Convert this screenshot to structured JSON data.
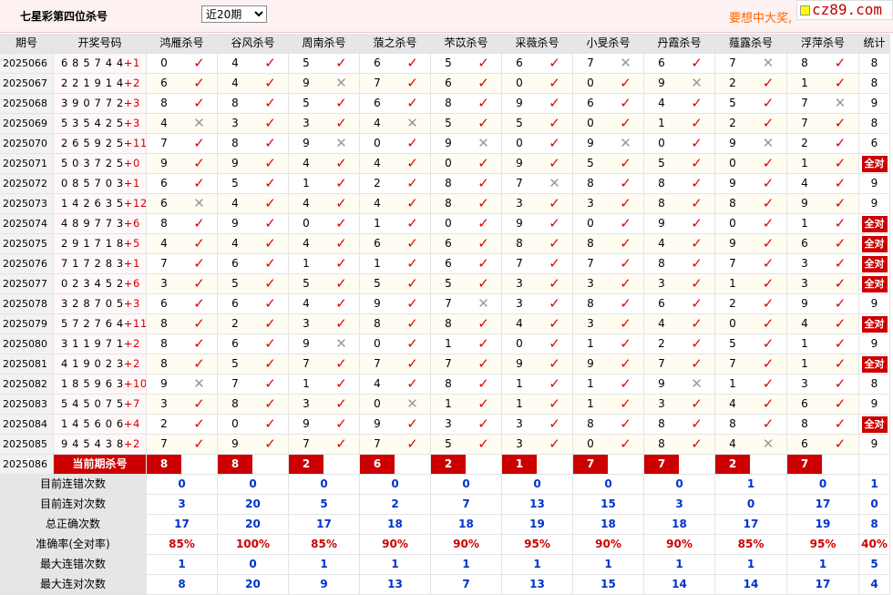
{
  "header": {
    "title": "七星彩第四位杀号",
    "period_select": "近20期",
    "ad_text": "要想中大奖,",
    "logo_text": "cz89.com"
  },
  "columns": [
    "期号",
    "开奖号码",
    "鸿雁杀号",
    "谷风杀号",
    "周南杀号",
    "蒗之杀号",
    "芣苡杀号",
    "采薇杀号",
    "小旻杀号",
    "丹霞杀号",
    "薤露杀号",
    "浮萍杀号",
    "统计"
  ],
  "full_badge_text": "全对",
  "rows": [
    {
      "issue": "2025066",
      "digits": "6 8 5 7 4 4",
      "plus": "+1",
      "kills": [
        [
          0,
          1
        ],
        [
          4,
          1
        ],
        [
          5,
          1
        ],
        [
          6,
          1
        ],
        [
          5,
          1
        ],
        [
          6,
          1
        ],
        [
          7,
          0
        ],
        [
          6,
          1
        ],
        [
          7,
          0
        ],
        [
          8,
          1
        ]
      ],
      "stat": "8",
      "full": false
    },
    {
      "issue": "2025067",
      "digits": "2 2 1 9 1 4",
      "plus": "+2",
      "kills": [
        [
          6,
          1
        ],
        [
          4,
          1
        ],
        [
          9,
          0
        ],
        [
          7,
          1
        ],
        [
          6,
          1
        ],
        [
          0,
          1
        ],
        [
          0,
          1
        ],
        [
          9,
          0
        ],
        [
          2,
          1
        ],
        [
          1,
          1
        ]
      ],
      "stat": "8",
      "full": false
    },
    {
      "issue": "2025068",
      "digits": "3 9 0 7 7 2",
      "plus": "+3",
      "kills": [
        [
          8,
          1
        ],
        [
          8,
          1
        ],
        [
          5,
          1
        ],
        [
          6,
          1
        ],
        [
          8,
          1
        ],
        [
          9,
          1
        ],
        [
          6,
          1
        ],
        [
          4,
          1
        ],
        [
          5,
          1
        ],
        [
          7,
          0
        ]
      ],
      "stat": "9",
      "full": false
    },
    {
      "issue": "2025069",
      "digits": "5 3 5 4 2 5",
      "plus": "+3",
      "kills": [
        [
          4,
          0
        ],
        [
          3,
          1
        ],
        [
          3,
          1
        ],
        [
          4,
          0
        ],
        [
          5,
          1
        ],
        [
          5,
          1
        ],
        [
          0,
          1
        ],
        [
          1,
          1
        ],
        [
          2,
          1
        ],
        [
          7,
          1
        ]
      ],
      "stat": "8",
      "full": false
    },
    {
      "issue": "2025070",
      "digits": "2 6 5 9 2 5",
      "plus": "+11",
      "kills": [
        [
          7,
          1
        ],
        [
          8,
          1
        ],
        [
          9,
          0
        ],
        [
          0,
          1
        ],
        [
          9,
          0
        ],
        [
          0,
          1
        ],
        [
          9,
          0
        ],
        [
          0,
          1
        ],
        [
          9,
          0
        ],
        [
          2,
          1
        ]
      ],
      "stat": "6",
      "full": false
    },
    {
      "issue": "2025071",
      "digits": "5 0 3 7 2 5",
      "plus": "+0",
      "kills": [
        [
          9,
          1
        ],
        [
          9,
          1
        ],
        [
          4,
          1
        ],
        [
          4,
          1
        ],
        [
          0,
          1
        ],
        [
          9,
          1
        ],
        [
          5,
          1
        ],
        [
          5,
          1
        ],
        [
          0,
          1
        ],
        [
          1,
          1
        ]
      ],
      "stat": "",
      "full": true
    },
    {
      "issue": "2025072",
      "digits": "0 8 5 7 0 3",
      "plus": "+1",
      "kills": [
        [
          6,
          1
        ],
        [
          5,
          1
        ],
        [
          1,
          1
        ],
        [
          2,
          1
        ],
        [
          8,
          1
        ],
        [
          7,
          0
        ],
        [
          8,
          1
        ],
        [
          8,
          1
        ],
        [
          9,
          1
        ],
        [
          4,
          1
        ]
      ],
      "stat": "9",
      "full": false
    },
    {
      "issue": "2025073",
      "digits": "1 4 2 6 3 5",
      "plus": "+12",
      "kills": [
        [
          6,
          0
        ],
        [
          4,
          1
        ],
        [
          4,
          1
        ],
        [
          4,
          1
        ],
        [
          8,
          1
        ],
        [
          3,
          1
        ],
        [
          3,
          1
        ],
        [
          8,
          1
        ],
        [
          8,
          1
        ],
        [
          9,
          1
        ]
      ],
      "stat": "9",
      "full": false
    },
    {
      "issue": "2025074",
      "digits": "4 8 9 7 7 3",
      "plus": "+6",
      "kills": [
        [
          8,
          1
        ],
        [
          9,
          1
        ],
        [
          0,
          1
        ],
        [
          1,
          1
        ],
        [
          0,
          1
        ],
        [
          9,
          1
        ],
        [
          0,
          1
        ],
        [
          9,
          1
        ],
        [
          0,
          1
        ],
        [
          1,
          1
        ]
      ],
      "stat": "",
      "full": true
    },
    {
      "issue": "2025075",
      "digits": "2 9 1 7 1 8",
      "plus": "+5",
      "kills": [
        [
          4,
          1
        ],
        [
          4,
          1
        ],
        [
          4,
          1
        ],
        [
          6,
          1
        ],
        [
          6,
          1
        ],
        [
          8,
          1
        ],
        [
          8,
          1
        ],
        [
          4,
          1
        ],
        [
          9,
          1
        ],
        [
          6,
          1
        ]
      ],
      "stat": "",
      "full": true
    },
    {
      "issue": "2025076",
      "digits": "7 1 7 2 8 3",
      "plus": "+1",
      "kills": [
        [
          7,
          1
        ],
        [
          6,
          1
        ],
        [
          1,
          1
        ],
        [
          1,
          1
        ],
        [
          6,
          1
        ],
        [
          7,
          1
        ],
        [
          7,
          1
        ],
        [
          8,
          1
        ],
        [
          7,
          1
        ],
        [
          3,
          1
        ]
      ],
      "stat": "",
      "full": true
    },
    {
      "issue": "2025077",
      "digits": "0 2 3 4 5 2",
      "plus": "+6",
      "kills": [
        [
          3,
          1
        ],
        [
          5,
          1
        ],
        [
          5,
          1
        ],
        [
          5,
          1
        ],
        [
          5,
          1
        ],
        [
          3,
          1
        ],
        [
          3,
          1
        ],
        [
          3,
          1
        ],
        [
          1,
          1
        ],
        [
          3,
          1
        ]
      ],
      "stat": "",
      "full": true
    },
    {
      "issue": "2025078",
      "digits": "3 2 8 7 0 5",
      "plus": "+3",
      "kills": [
        [
          6,
          1
        ],
        [
          6,
          1
        ],
        [
          4,
          1
        ],
        [
          9,
          1
        ],
        [
          7,
          0
        ],
        [
          3,
          1
        ],
        [
          8,
          1
        ],
        [
          6,
          1
        ],
        [
          2,
          1
        ],
        [
          9,
          1
        ]
      ],
      "stat": "9",
      "full": false
    },
    {
      "issue": "2025079",
      "digits": "5 7 2 7 6 4",
      "plus": "+11",
      "kills": [
        [
          8,
          1
        ],
        [
          2,
          1
        ],
        [
          3,
          1
        ],
        [
          8,
          1
        ],
        [
          8,
          1
        ],
        [
          4,
          1
        ],
        [
          3,
          1
        ],
        [
          4,
          1
        ],
        [
          0,
          1
        ],
        [
          4,
          1
        ]
      ],
      "stat": "",
      "full": true
    },
    {
      "issue": "2025080",
      "digits": "3 1 1 9 7 1",
      "plus": "+2",
      "kills": [
        [
          8,
          1
        ],
        [
          6,
          1
        ],
        [
          9,
          0
        ],
        [
          0,
          1
        ],
        [
          1,
          1
        ],
        [
          0,
          1
        ],
        [
          1,
          1
        ],
        [
          2,
          1
        ],
        [
          5,
          1
        ],
        [
          1,
          1
        ]
      ],
      "stat": "9",
      "full": false
    },
    {
      "issue": "2025081",
      "digits": "4 1 9 0 2 3",
      "plus": "+2",
      "kills": [
        [
          8,
          1
        ],
        [
          5,
          1
        ],
        [
          7,
          1
        ],
        [
          7,
          1
        ],
        [
          7,
          1
        ],
        [
          9,
          1
        ],
        [
          9,
          1
        ],
        [
          7,
          1
        ],
        [
          7,
          1
        ],
        [
          1,
          1
        ]
      ],
      "stat": "",
      "full": true
    },
    {
      "issue": "2025082",
      "digits": "1 8 5 9 6 3",
      "plus": "+10",
      "kills": [
        [
          9,
          0
        ],
        [
          7,
          1
        ],
        [
          1,
          1
        ],
        [
          4,
          1
        ],
        [
          8,
          1
        ],
        [
          1,
          1
        ],
        [
          1,
          1
        ],
        [
          9,
          0
        ],
        [
          1,
          1
        ],
        [
          3,
          1
        ]
      ],
      "stat": "8",
      "full": false
    },
    {
      "issue": "2025083",
      "digits": "5 4 5 0 7 5",
      "plus": "+7",
      "kills": [
        [
          3,
          1
        ],
        [
          8,
          1
        ],
        [
          3,
          1
        ],
        [
          0,
          0
        ],
        [
          1,
          1
        ],
        [
          1,
          1
        ],
        [
          1,
          1
        ],
        [
          3,
          1
        ],
        [
          4,
          1
        ],
        [
          6,
          1
        ]
      ],
      "stat": "9",
      "full": false
    },
    {
      "issue": "2025084",
      "digits": "1 4 5 6 0 6",
      "plus": "+4",
      "kills": [
        [
          2,
          1
        ],
        [
          0,
          1
        ],
        [
          9,
          1
        ],
        [
          9,
          1
        ],
        [
          3,
          1
        ],
        [
          3,
          1
        ],
        [
          8,
          1
        ],
        [
          8,
          1
        ],
        [
          8,
          1
        ],
        [
          8,
          1
        ]
      ],
      "stat": "",
      "full": true
    },
    {
      "issue": "2025085",
      "digits": "9 4 5 4 3 8",
      "plus": "+2",
      "kills": [
        [
          7,
          1
        ],
        [
          9,
          1
        ],
        [
          7,
          1
        ],
        [
          7,
          1
        ],
        [
          5,
          1
        ],
        [
          3,
          1
        ],
        [
          0,
          1
        ],
        [
          8,
          1
        ],
        [
          4,
          0
        ],
        [
          6,
          1
        ]
      ],
      "stat": "9",
      "full": false
    }
  ],
  "current": {
    "issue": "2025086",
    "label": "当前期杀号",
    "values": [
      "8",
      "8",
      "2",
      "6",
      "2",
      "1",
      "7",
      "7",
      "2",
      "7"
    ]
  },
  "stats": [
    {
      "label": "目前连错次数",
      "values": [
        "0",
        "0",
        "0",
        "0",
        "0",
        "0",
        "0",
        "0",
        "1",
        "0"
      ],
      "total": "1"
    },
    {
      "label": "目前连对次数",
      "values": [
        "3",
        "20",
        "5",
        "2",
        "7",
        "13",
        "15",
        "3",
        "0",
        "17"
      ],
      "total": "0"
    },
    {
      "label": "总正确次数",
      "values": [
        "17",
        "20",
        "17",
        "18",
        "18",
        "19",
        "18",
        "18",
        "17",
        "19"
      ],
      "total": "8"
    },
    {
      "label": "准确率(全对率)",
      "values": [
        "85%",
        "100%",
        "85%",
        "90%",
        "90%",
        "95%",
        "90%",
        "90%",
        "85%",
        "95%"
      ],
      "total": "40%",
      "red": true
    },
    {
      "label": "最大连错次数",
      "values": [
        "1",
        "0",
        "1",
        "1",
        "1",
        "1",
        "1",
        "1",
        "1",
        "1"
      ],
      "total": "5"
    },
    {
      "label": "最大连对次数",
      "values": [
        "8",
        "20",
        "9",
        "13",
        "7",
        "13",
        "15",
        "14",
        "14",
        "17"
      ],
      "total": "4"
    }
  ],
  "colors": {
    "accent_red": "#cc0000",
    "stat_blue": "#0033cc",
    "check_red": "#e00000",
    "cross_gray": "#999999"
  }
}
